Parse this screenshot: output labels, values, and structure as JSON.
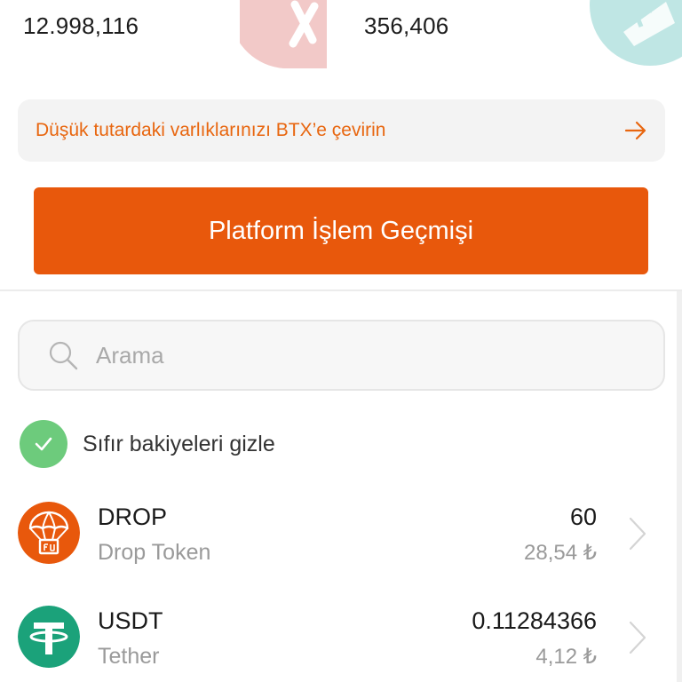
{
  "stats": {
    "left_value": "12.998,116",
    "right_value": "356,406"
  },
  "convert_banner": {
    "text": "Düşük tutardaki varlıklarınızı BTX’e çevirin",
    "icon": "arrow-right-icon",
    "color": "#e8660f"
  },
  "history_button": {
    "label": "Platform İşlem Geçmişi",
    "color": "#e8580c"
  },
  "search": {
    "placeholder": "Arama",
    "value": "",
    "icon": "search-icon"
  },
  "hide_zero": {
    "label": "Sıfır bakiyeleri gizle",
    "checked": true,
    "color": "#6dcb7c"
  },
  "assets": [
    {
      "symbol": "DROP",
      "name": "Drop Token",
      "amount": "60",
      "fiat": "28,54 ₺",
      "icon": "parachute-icon",
      "color": "#e8580c"
    },
    {
      "symbol": "USDT",
      "name": "Tether",
      "amount": "0.11284366",
      "fiat": "4,12 ₺",
      "icon": "tether-icon",
      "color": "#1ba27a"
    }
  ]
}
